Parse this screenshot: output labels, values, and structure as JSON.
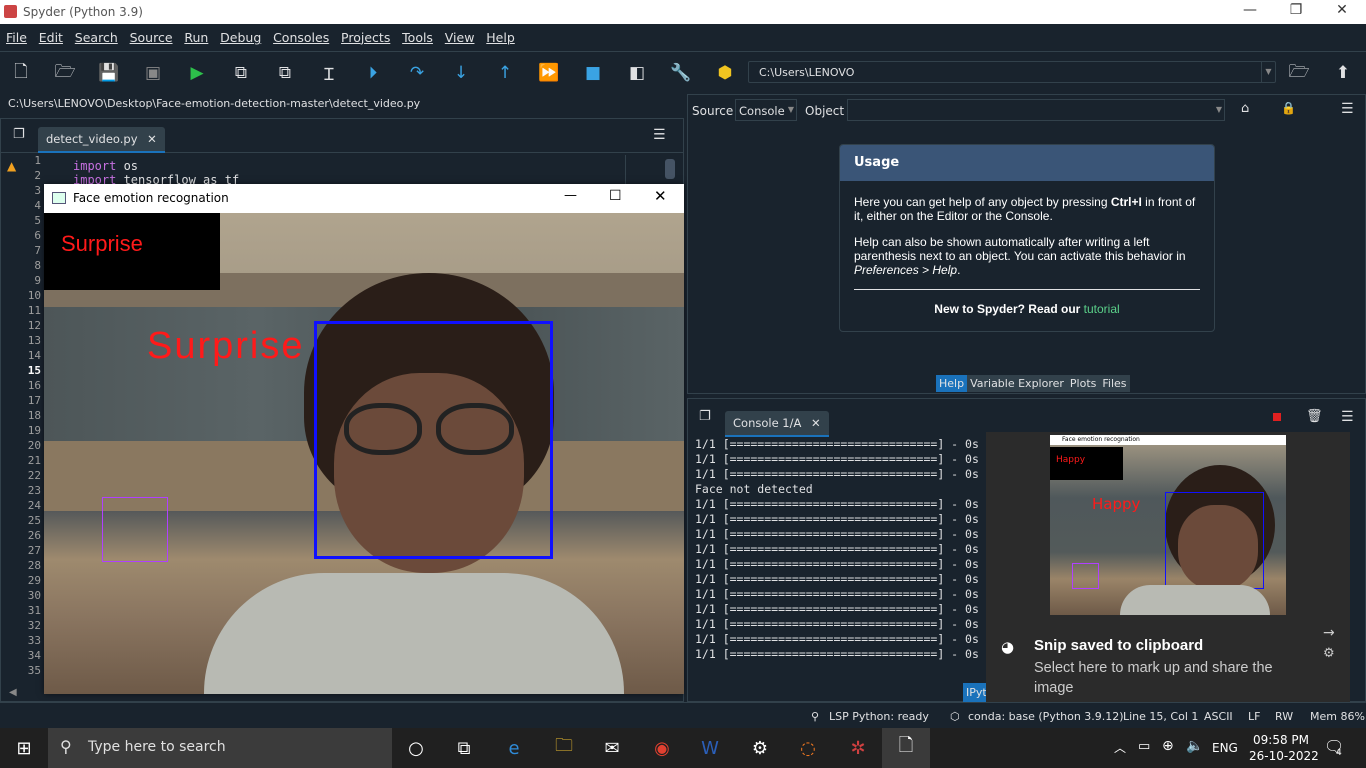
{
  "window": {
    "title": "Spyder (Python 3.9)"
  },
  "menu": [
    "File",
    "Edit",
    "Search",
    "Source",
    "Run",
    "Debug",
    "Consoles",
    "Projects",
    "Tools",
    "View",
    "Help"
  ],
  "toolbar": {
    "path": "C:\\Users\\LENOVO"
  },
  "editor": {
    "path": "C:\\Users\\LENOVO\\Desktop\\Face-emotion-detection-master\\detect_video.py",
    "tab": "detect_video.py",
    "line_numbers": [
      "1",
      "2",
      "3",
      "4",
      "5",
      "6",
      "7",
      "8",
      "9",
      "10",
      "11",
      "12",
      "13",
      "14",
      "15",
      "16",
      "17",
      "18",
      "19",
      "20",
      "21",
      "22",
      "23",
      "24",
      "25",
      "26",
      "27",
      "28",
      "29",
      "30",
      "31",
      "32",
      "33",
      "34",
      "35"
    ],
    "code_kw1": "import",
    "code_rest1": " os",
    "code_kw2": "import",
    "code_rest2": " tensorflow as tf"
  },
  "face_window": {
    "title": "Face emotion recognation",
    "label_box": "Surprise",
    "label_face": "Surprise"
  },
  "help": {
    "source_label": "Source",
    "source_value": "Console",
    "object_label": "Object",
    "usage_title": "Usage",
    "p1_a": "Here you can get help of any object by pressing ",
    "p1_b": "Ctrl+I",
    "p1_c": " in front of it, either on the Editor or the Console.",
    "p2_a": "Help can also be shown automatically after writing a left parenthesis next to an object. You can activate this behavior in ",
    "p2_b": "Preferences > Help",
    "p2_c": ".",
    "new_a": "New to Spyder? Read our ",
    "new_link": "tutorial"
  },
  "panel_tabs": [
    "Help",
    "Variable Explorer",
    "Plots",
    "Files"
  ],
  "console": {
    "tab": "Console 1/A",
    "lines": [
      "1/1 [==============================] - 0s",
      "1/1 [==============================] - 0s",
      "1/1 [==============================] - 0s",
      "Face not detected",
      "1/1 [==============================] - 0s",
      "1/1 [==============================] - 0s",
      "1/1 [==============================] - 0s",
      "1/1 [==============================] - 0s",
      "1/1 [==============================] - 0s",
      "1/1 [==============================] - 0s",
      "1/1 [==============================] - 0s",
      "1/1 [==============================] - 0s",
      "1/1 [==============================] - 0s",
      "1/1 [==============================] - 0s",
      "1/1 [==============================] - 0s"
    ],
    "ipy_tab": "IPyt"
  },
  "toast": {
    "thumb_title": "Face emotion recognation",
    "thumb_label_box": "Happy",
    "thumb_label_face": "Happy",
    "title": "Snip saved to clipboard",
    "body": "Select here to mark up and share the image"
  },
  "status": {
    "lsp": "LSP Python: ready",
    "conda": "conda: base (Python 3.9.12)",
    "pos": "Line 15, Col 1",
    "enc": "ASCII",
    "eol": "LF",
    "rw": "RW",
    "mem": "Mem 86%"
  },
  "taskbar": {
    "search": "Type here to search",
    "lang": "ENG",
    "time": "09:58 PM",
    "date": "26-10-2022",
    "notif": "4"
  }
}
